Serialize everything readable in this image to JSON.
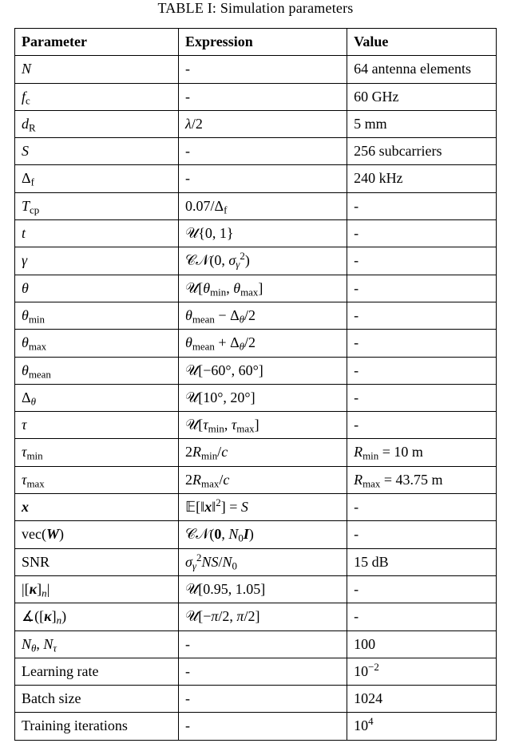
{
  "caption": "TABLE I: Simulation parameters",
  "headers": {
    "c1": "Parameter",
    "c2": "Expression",
    "c3": "Value"
  },
  "rows": [
    {
      "param_html": "<span class='mi'>N</span>",
      "expr_html": "-",
      "value_html": "64 antenna elements"
    },
    {
      "param_html": "<span class='mi'>f</span><sub><span class='rm'>c</span></sub>",
      "expr_html": "-",
      "value_html": "60 GHz"
    },
    {
      "param_html": "<span class='mi'>d</span><sub><span class='rm'>R</span></sub>",
      "expr_html": "<span class='mi'>λ</span>/2",
      "value_html": "5 mm"
    },
    {
      "param_html": "<span class='mi'>S</span>",
      "expr_html": "-",
      "value_html": "256 subcarriers"
    },
    {
      "param_html": "Δ<sub><span class='rm'>f</span></sub>",
      "expr_html": "-",
      "value_html": "240 kHz"
    },
    {
      "param_html": "<span class='mi'>T</span><sub><span class='rm'>cp</span></sub>",
      "expr_html": "0.07/Δ<sub><span class='rm'>f</span></sub>",
      "value_html": "-"
    },
    {
      "param_html": "<span class='mi'>t</span>",
      "expr_html": "<span class='cal'>𝒰</span>{0, 1}",
      "value_html": "-"
    },
    {
      "param_html": "<span class='mi'>γ</span>",
      "expr_html": "<span class='cal'>𝒞𝒩</span>(0, <span class='mi'>σ</span><sub><span class='mi'>γ</span></sub><sup>2</sup>)",
      "value_html": "-"
    },
    {
      "param_html": "<span class='mi'>θ</span>",
      "expr_html": "<span class='cal'>𝒰</span>[<span class='mi'>θ</span><sub><span class='rm'>min</span></sub>, <span class='mi'>θ</span><sub><span class='rm'>max</span></sub>]",
      "value_html": "-"
    },
    {
      "param_html": "<span class='mi'>θ</span><sub><span class='rm'>min</span></sub>",
      "expr_html": "<span class='mi'>θ</span><sub><span class='rm'>mean</span></sub> − Δ<sub><span class='mi'>θ</span></sub>/2",
      "value_html": "-"
    },
    {
      "param_html": "<span class='mi'>θ</span><sub><span class='rm'>max</span></sub>",
      "expr_html": "<span class='mi'>θ</span><sub><span class='rm'>mean</span></sub> + Δ<sub><span class='mi'>θ</span></sub>/2",
      "value_html": "-"
    },
    {
      "param_html": "<span class='mi'>θ</span><sub><span class='rm'>mean</span></sub>",
      "expr_html": "<span class='cal'>𝒰</span>[−60°, 60°]",
      "value_html": "-"
    },
    {
      "param_html": "Δ<sub><span class='mi'>θ</span></sub>",
      "expr_html": "<span class='cal'>𝒰</span>[10°, 20°]",
      "value_html": "-"
    },
    {
      "param_html": "<span class='mi'>τ</span>",
      "expr_html": "<span class='cal'>𝒰</span>[<span class='mi'>τ</span><sub><span class='rm'>min</span></sub>, <span class='mi'>τ</span><sub><span class='rm'>max</span></sub>]",
      "value_html": "-"
    },
    {
      "param_html": "<span class='mi'>τ</span><sub><span class='rm'>min</span></sub>",
      "expr_html": "2<span class='mi'>R</span><sub><span class='rm'>min</span></sub>/<span class='mi'>c</span>",
      "value_html": "<span class='mi'>R</span><sub><span class='rm'>min</span></sub> = 10 m"
    },
    {
      "param_html": "<span class='mi'>τ</span><sub><span class='rm'>max</span></sub>",
      "expr_html": "2<span class='mi'>R</span><sub><span class='rm'>max</span></sub>/<span class='mi'>c</span>",
      "value_html": "<span class='mi'>R</span><sub><span class='rm'>max</span></sub> = 43.75 m"
    },
    {
      "param_html": "<span class='bi'>x</span>",
      "expr_html": "𝔼[‖<span class='bi'>x</span>‖<sup>2</sup>] = <span class='mi'>S</span>",
      "value_html": "-"
    },
    {
      "param_html": "<span class='rm'>vec</span>(<span class='bi'>W</span>)",
      "expr_html": "<span class='cal'>𝒞𝒩</span>(<span class='bb'>0</span>, <span class='mi'>N</span><sub>0</sub><span class='bi'>I</span>)",
      "value_html": "-"
    },
    {
      "param_html": "<span class='rm'>SNR</span>",
      "expr_html": "<span class='mi'>σ</span><sub><span class='mi'>γ</span></sub><sup>2</sup><span class='mi'>N</span><span class='mi'>S</span>/<span class='mi'>N</span><sub>0</sub>",
      "value_html": "15 dB"
    },
    {
      "param_html": "|[<span class='bi'>κ</span>]<sub><span class='mi'>n</span></sub>|",
      "expr_html": "<span class='cal'>𝒰</span>[0.95, 1.05]",
      "value_html": "-"
    },
    {
      "param_html": "∡([<span class='bi'>κ</span>]<sub><span class='mi'>n</span></sub>)",
      "expr_html": "<span class='cal'>𝒰</span>[−<span class='mi'>π</span>/2, <span class='mi'>π</span>/2]",
      "value_html": "-"
    },
    {
      "param_html": "<span class='mi'>N</span><sub><span class='mi'>θ</span></sub>, <span class='mi'>N</span><sub><span class='mi'>τ</span></sub>",
      "expr_html": "-",
      "value_html": "100"
    },
    {
      "param_html": "Learning rate",
      "expr_html": "-",
      "value_html": "10<sup>−2</sup>"
    },
    {
      "param_html": "Batch size",
      "expr_html": "-",
      "value_html": "1024"
    },
    {
      "param_html": "Training iterations",
      "expr_html": "-",
      "value_html": "10<sup>4</sup>"
    }
  ],
  "chart_data": {
    "type": "table",
    "title": "TABLE I: Simulation parameters",
    "columns": [
      "Parameter",
      "Expression",
      "Value"
    ],
    "rows": [
      [
        "N",
        "-",
        "64 antenna elements"
      ],
      [
        "f_c",
        "-",
        "60 GHz"
      ],
      [
        "d_R",
        "λ/2",
        "5 mm"
      ],
      [
        "S",
        "-",
        "256 subcarriers"
      ],
      [
        "Δ_f",
        "-",
        "240 kHz"
      ],
      [
        "T_cp",
        "0.07/Δ_f",
        "-"
      ],
      [
        "t",
        "U{0, 1}",
        "-"
      ],
      [
        "γ",
        "CN(0, σ_γ^2)",
        "-"
      ],
      [
        "θ",
        "U[θ_min, θ_max]",
        "-"
      ],
      [
        "θ_min",
        "θ_mean − Δ_θ/2",
        "-"
      ],
      [
        "θ_max",
        "θ_mean + Δ_θ/2",
        "-"
      ],
      [
        "θ_mean",
        "U[−60°, 60°]",
        "-"
      ],
      [
        "Δ_θ",
        "U[10°, 20°]",
        "-"
      ],
      [
        "τ",
        "U[τ_min, τ_max]",
        "-"
      ],
      [
        "τ_min",
        "2R_min/c",
        "R_min = 10 m"
      ],
      [
        "τ_max",
        "2R_max/c",
        "R_max = 43.75 m"
      ],
      [
        "x (bold)",
        "E[‖x‖^2] = S",
        "-"
      ],
      [
        "vec(W)",
        "CN(0, N_0 I)",
        "-"
      ],
      [
        "SNR",
        "σ_γ^2 N S / N_0",
        "15 dB"
      ],
      [
        "|[κ]_n|",
        "U[0.95, 1.05]",
        "-"
      ],
      [
        "∠([κ]_n)",
        "U[−π/2, π/2]",
        "-"
      ],
      [
        "N_θ, N_τ",
        "-",
        "100"
      ],
      [
        "Learning rate",
        "-",
        "10^{-2}"
      ],
      [
        "Batch size",
        "-",
        "1024"
      ],
      [
        "Training iterations",
        "-",
        "10^{4}"
      ]
    ]
  }
}
